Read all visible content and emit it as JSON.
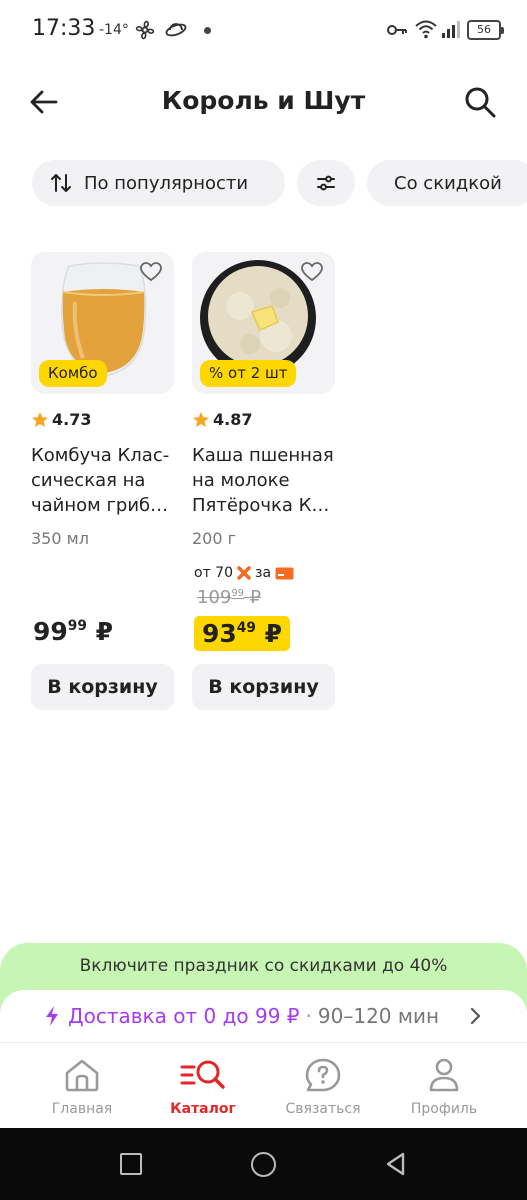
{
  "status_bar": {
    "time": "17:33",
    "temperature": "-14°",
    "battery": "56",
    "icons": [
      "fan-icon",
      "satellite-icon",
      "notification-dot",
      "key-icon",
      "wifi-icon",
      "signal-icon",
      "battery-icon"
    ]
  },
  "header": {
    "title": "Король и Шут",
    "back_icon": "arrow-left-icon",
    "search_icon": "search-icon"
  },
  "filters": {
    "sort_label": "По популярности",
    "settings_icon": "sliders-icon",
    "discount_label": "Со скидкой"
  },
  "products": [
    {
      "badge": "Комбо",
      "rating": "4.73",
      "name": "Комбуча Клас-сическая на чайном гриб…",
      "weight": "350 мл",
      "price_int": "99",
      "price_frac": "99",
      "currency": "₽",
      "cart_label": "В корзину"
    },
    {
      "badge": "% от 2 шт",
      "rating": "4.87",
      "name": "Каша пшенная на молоке Пятёрочка К…",
      "weight": "200 г",
      "promo_prefix": "от 70",
      "promo_mid": "за",
      "old_price_int": "109",
      "old_price_frac": "99",
      "price_int": "93",
      "price_frac": "49",
      "currency": "₽",
      "cart_label": "В корзину"
    }
  ],
  "promo": {
    "text": "Включите праздник со скидками до 40%",
    "delivery_main": "Доставка от 0 до 99 ₽",
    "delivery_sep": "·",
    "delivery_time": "90–120 мин",
    "accent_color": "#a63cf0",
    "banner_color": "#c7f5b4"
  },
  "nav": {
    "home": "Главная",
    "catalog": "Каталог",
    "contact": "Связаться",
    "profile": "Профиль",
    "active_color": "#e32626"
  },
  "colors": {
    "badge_yellow": "#ffd700",
    "star_orange": "#f5a623"
  }
}
